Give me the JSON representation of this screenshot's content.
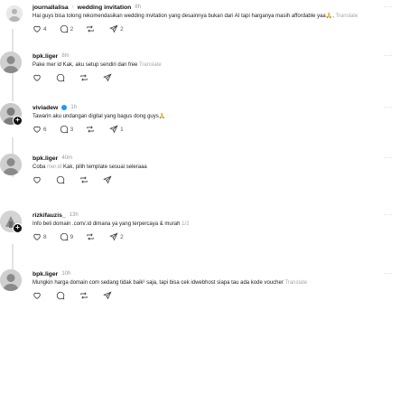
{
  "posts": [
    {
      "username": "journallalisa",
      "topic": "wedding invitation",
      "time": "8h",
      "text": "Hai guys bisa tolong rekomendasikan wedding invitation yang desainnya bukan dari AI tapi harganya masih affordable yaa🙏, ",
      "translate": "Translate",
      "likes": "4",
      "comments": "2",
      "reposts": "",
      "shares": "2"
    },
    {
      "username": "bpk.liger",
      "time": "8m",
      "text": "Pake mer id Kak, aku setup sendiri dan free ",
      "translate": "Translate",
      "likes": "",
      "comments": "",
      "reposts": "",
      "shares": ""
    },
    {
      "username": "viviadew",
      "time": "1h",
      "text": "Tawarin aku undangan digital yang bagus dong guys🙏",
      "likes": "6",
      "comments": "3",
      "reposts": "",
      "shares": "1"
    },
    {
      "username": "bpk.liger",
      "time": "40m",
      "text_before": "Coba ",
      "text_link": "mer.id",
      "text_after": " Kak, pilih template sesuai seleraaa",
      "likes": "",
      "comments": "",
      "reposts": "",
      "shares": ""
    },
    {
      "username": "rizkifauzis_",
      "time": "13h",
      "text": "Info beli domain .com/.id dimana ya yang terpercaya & murah ",
      "page": "1/2",
      "likes": "8",
      "comments": "9",
      "reposts": "",
      "shares": "2"
    },
    {
      "username": "bpk.liger",
      "time": "10h",
      "text": "Mungkin harga domain com sedang tidak baik² saja, tapi bisa cek idwebhost siapa tau ada kode voucher ",
      "translate": "Translate",
      "likes": "",
      "comments": "",
      "reposts": "",
      "shares": ""
    }
  ],
  "icons": {
    "like": "heart-icon",
    "comment": "comment-icon",
    "repost": "repost-icon",
    "share": "share-icon",
    "more": "more-icon"
  },
  "colors": {
    "verified": "#1d9bf0",
    "muted": "#9a9a9a",
    "text": "#101010"
  }
}
